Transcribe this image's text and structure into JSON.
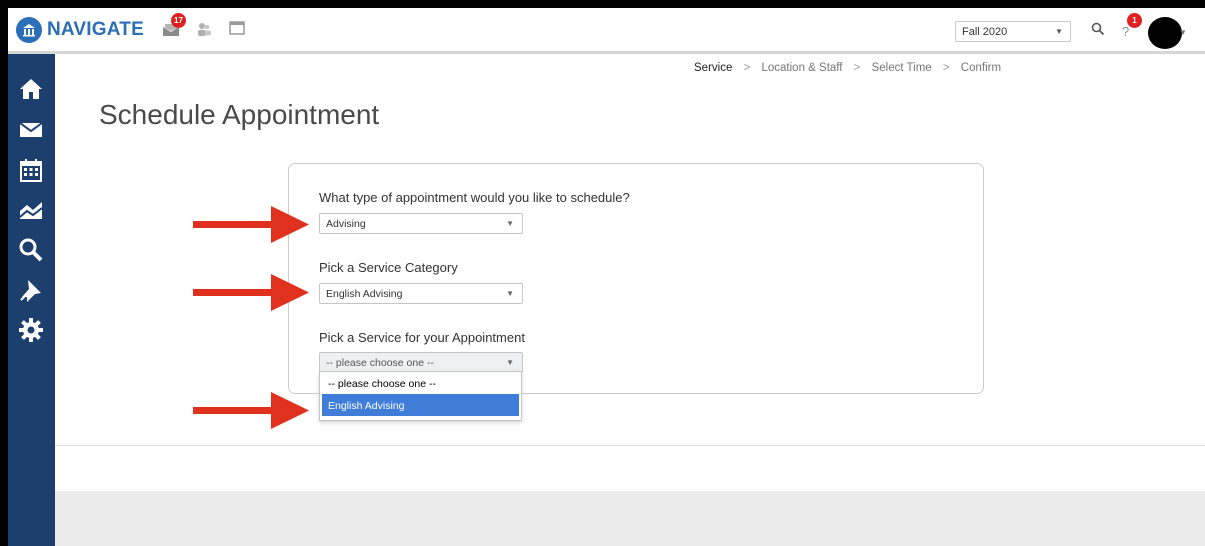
{
  "app": {
    "brand": "NAVIGATE"
  },
  "header": {
    "messages_badge": "17",
    "help_badge": "1",
    "term": "Fall 2020"
  },
  "sidebar": {
    "items": [
      "home-icon",
      "mail-icon",
      "calendar-icon",
      "chart-icon",
      "search-icon",
      "pin-icon",
      "gear-icon"
    ]
  },
  "steps": {
    "service": "Service",
    "location": "Location & Staff",
    "time": "Select Time",
    "confirm": "Confirm",
    "separator": ">"
  },
  "page": {
    "title": "Schedule Appointment"
  },
  "form": {
    "q1_label": "What type of appointment would you like to schedule?",
    "q1_value": "Advising",
    "q2_label": "Pick a Service Category",
    "q2_value": "English Advising",
    "q3_label": "Pick a Service for your Appointment",
    "q3_value": "-- please choose one --",
    "q3_options": [
      "-- please choose one --",
      "English Advising"
    ]
  },
  "colors": {
    "brand": "#2a6fb7",
    "sidebar": "#1c3f6e",
    "arrow": "#e0301e",
    "selected": "#3f7dd9"
  }
}
